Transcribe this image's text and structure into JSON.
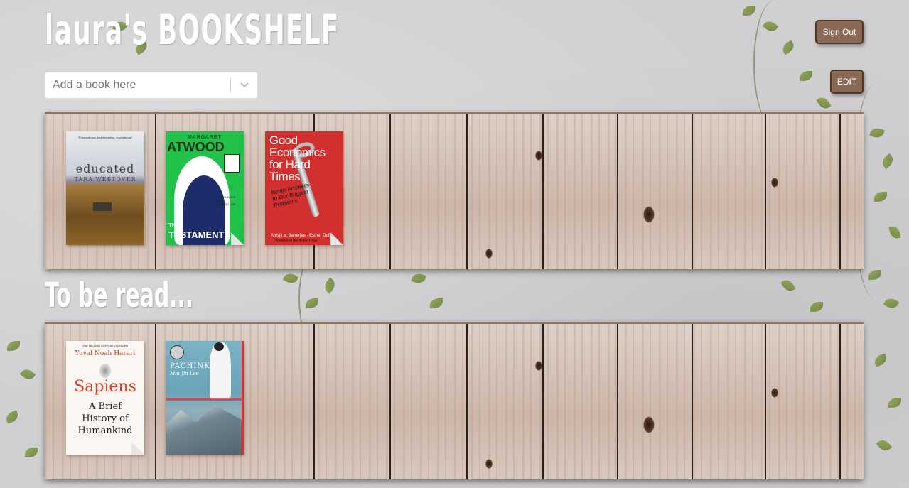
{
  "app": {
    "title": "laura's BOOKSHELF"
  },
  "header": {
    "signout_label": "Sign Out",
    "edit_label": "EDIT"
  },
  "search": {
    "placeholder": "Add a book here"
  },
  "sections": {
    "tbr_title": "To be read..."
  },
  "shelf_read": {
    "books": [
      {
        "title": "educated",
        "author": "TARA WESTOVER",
        "blurb": "\"Extraordinary, heartbreaking, inspirational\""
      },
      {
        "author_first": "MARGARET",
        "author_last": "ATWOOD",
        "title_the": "THE",
        "title_main": "TESTAMENTS",
        "tagline": "THE NUMBER ONE BESTSELLER"
      },
      {
        "title": "Good Economics for Hard Times",
        "subtitle": "Better Answers to Our Biggest Problems",
        "authors": "Abhijit V. Banerjee · Esther Duflo",
        "note": "Winners of the Nobel Prize"
      }
    ]
  },
  "shelf_tbr": {
    "books": [
      {
        "top": "THE MILLION COPY BESTSELLER",
        "author": "Yuval Noah Harari",
        "title": "Sapiens",
        "subtitle": "A Brief History of Humankind"
      },
      {
        "title": "PACHINKO",
        "author": "Min Jin Lee"
      }
    ]
  },
  "colors": {
    "button_bg": "#8a6a55",
    "button_border": "#4e3628",
    "title_text": "#ffffff"
  },
  "icons": {
    "dropdown": "chevron-down-icon"
  }
}
